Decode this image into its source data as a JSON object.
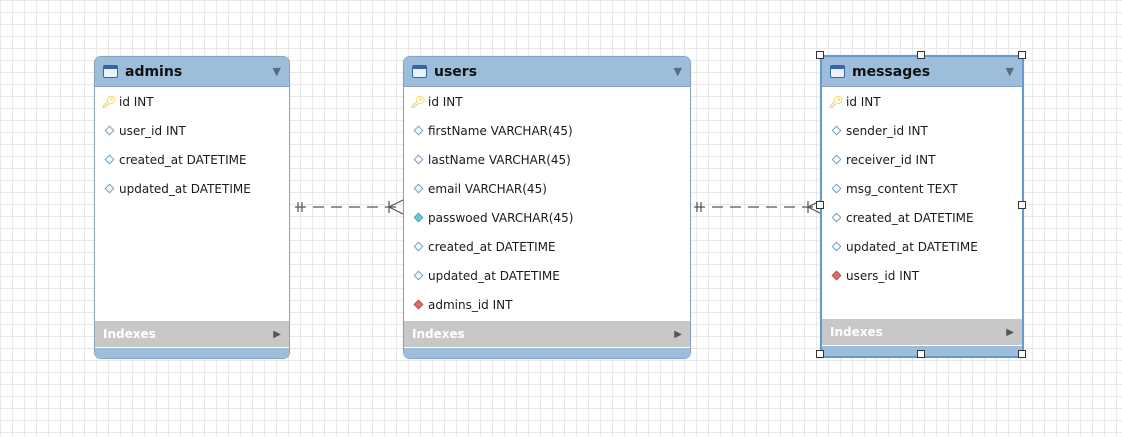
{
  "tables": {
    "admins": {
      "name": "admins",
      "columns": [
        {
          "text": "id INT",
          "kind": "key"
        },
        {
          "text": "user_id INT",
          "kind": "hollow"
        },
        {
          "text": "created_at DATETIME",
          "kind": "hollow"
        },
        {
          "text": "updated_at DATETIME",
          "kind": "hollow"
        }
      ],
      "indexes_label": "Indexes"
    },
    "users": {
      "name": "users",
      "columns": [
        {
          "text": "id INT",
          "kind": "key"
        },
        {
          "text": "firstName VARCHAR(45)",
          "kind": "hollow"
        },
        {
          "text": "lastName VARCHAR(45)",
          "kind": "hollow"
        },
        {
          "text": "email VARCHAR(45)",
          "kind": "hollow"
        },
        {
          "text": "passwoed VARCHAR(45)",
          "kind": "filled"
        },
        {
          "text": "created_at DATETIME",
          "kind": "hollow"
        },
        {
          "text": "updated_at DATETIME",
          "kind": "hollow"
        },
        {
          "text": "admins_id INT",
          "kind": "fk"
        }
      ],
      "indexes_label": "Indexes"
    },
    "messages": {
      "name": "messages",
      "columns": [
        {
          "text": "id INT",
          "kind": "key"
        },
        {
          "text": "sender_id INT",
          "kind": "hollow"
        },
        {
          "text": "receiver_id INT",
          "kind": "hollow"
        },
        {
          "text": "msg_content TEXT",
          "kind": "hollow"
        },
        {
          "text": "created_at DATETIME",
          "kind": "hollow"
        },
        {
          "text": "updated_at DATETIME",
          "kind": "hollow"
        },
        {
          "text": "users_id INT",
          "kind": "fk"
        }
      ],
      "indexes_label": "Indexes"
    }
  },
  "relationships": [
    {
      "from": "admins",
      "to": "users",
      "from_cardinality": "one-and-only-one",
      "to_cardinality": "one-or-many",
      "style": "dashed"
    },
    {
      "from": "users",
      "to": "messages",
      "from_cardinality": "one-and-only-one",
      "to_cardinality": "one-or-many",
      "style": "dashed"
    }
  ],
  "selected_table": "messages",
  "colors": {
    "header": "#9cbedb",
    "indexes_bar": "#c8c8c8",
    "key": "#e6b800",
    "fk_diamond": "#d9706d",
    "column_diamond": "#6f9ec9",
    "connector": "#555555"
  }
}
